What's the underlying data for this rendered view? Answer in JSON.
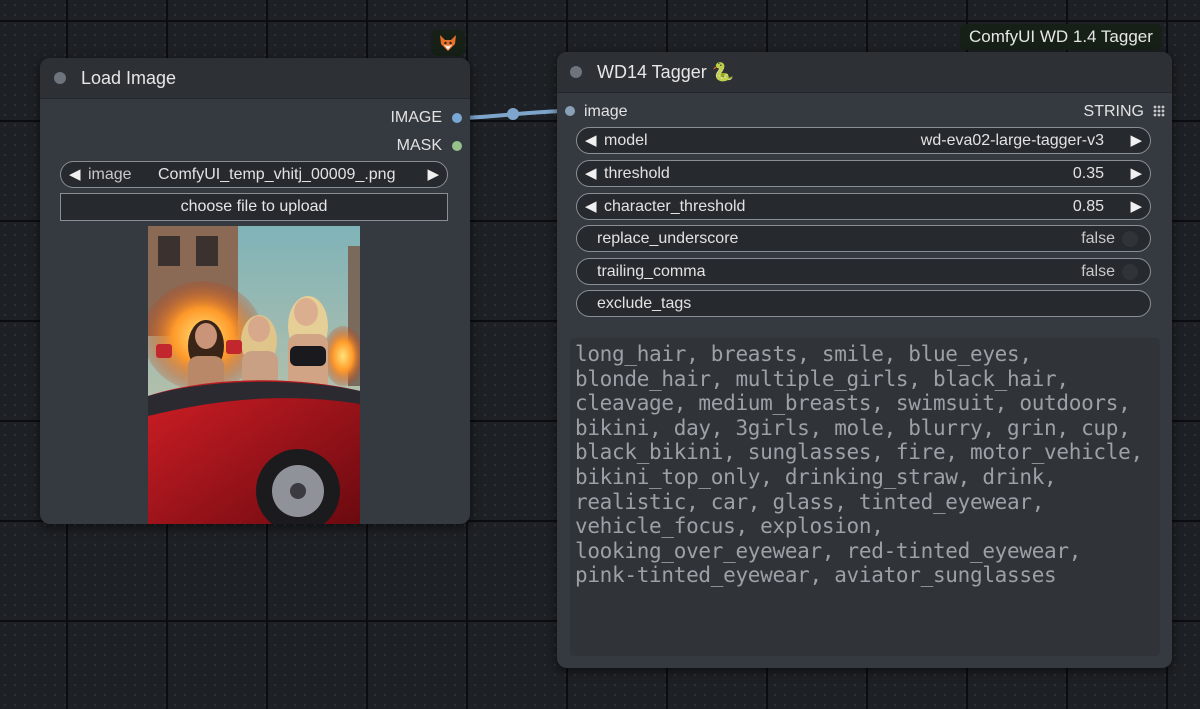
{
  "load_image_node": {
    "title": "Load Image",
    "outputs": {
      "image": "IMAGE",
      "mask": "MASK"
    },
    "image_widget": {
      "label": "image",
      "value": "ComfyUI_temp_vhitj_00009_.png"
    },
    "upload_label": "choose file to upload",
    "badge_icon": "fox-icon"
  },
  "tagger_node": {
    "title": "WD14 Tagger 🐍",
    "badge": "ComfyUI WD 1.4 Tagger",
    "input_label": "image",
    "output_label": "STRING",
    "widgets": {
      "model": {
        "label": "model",
        "value": "wd-eva02-large-tagger-v3"
      },
      "threshold": {
        "label": "threshold",
        "value": "0.35"
      },
      "character_threshold": {
        "label": "character_threshold",
        "value": "0.85"
      },
      "replace_underscore": {
        "label": "replace_underscore",
        "value": "false"
      },
      "trailing_comma": {
        "label": "trailing_comma",
        "value": "false"
      },
      "exclude_tags": {
        "label": "exclude_tags"
      }
    },
    "output_text": "long_hair, breasts, smile, blue_eyes, blonde_hair, multiple_girls, black_hair, cleavage, medium_breasts, swimsuit, outdoors, bikini, day, 3girls, mole, blurry, grin, cup, black_bikini, sunglasses, fire, motor_vehicle, bikini_top_only, drinking_straw, drink, realistic, car, glass, tinted_eyewear, vehicle_focus, explosion, looking_over_eyewear, red-tinted_eyewear, pink-tinted_eyewear, aviator_sunglasses"
  },
  "colors": {
    "image_port": "#7aa7d6",
    "mask_port": "#98c08a",
    "link": "#7ea6cc",
    "badge_bg": "#162016"
  }
}
